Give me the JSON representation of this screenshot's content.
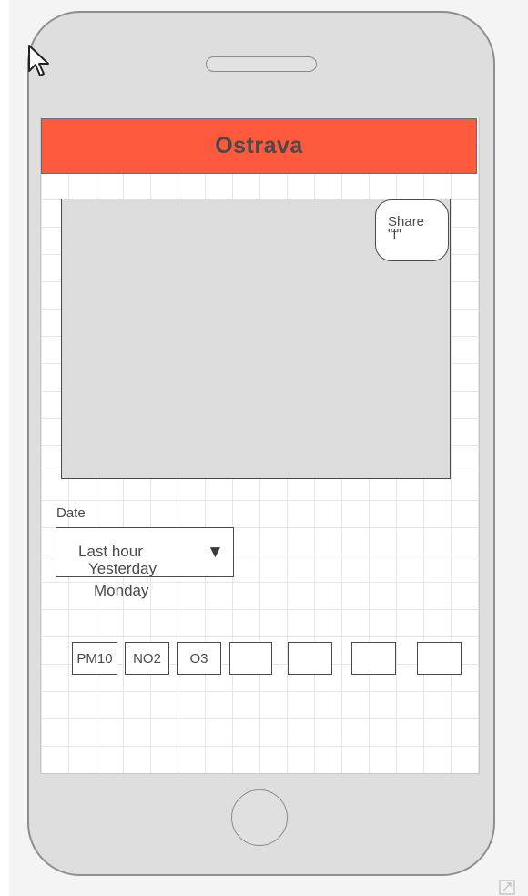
{
  "header": {
    "title": "Ostrava"
  },
  "map": {
    "share_label": "Share",
    "share_icon_text": "\"f\""
  },
  "date": {
    "label": "Date",
    "options": [
      "Last hour",
      "Yesterday",
      "Monday"
    ]
  },
  "pollutants": [
    "PM10",
    "NO2",
    "O3",
    "",
    "",
    "",
    ""
  ],
  "colors": {
    "header": "#fd5a3d"
  },
  "icons": {
    "cursor": "mouse-pointer-icon",
    "dropdown": "triangle-down-icon",
    "corner": "resize-corner-icon"
  }
}
